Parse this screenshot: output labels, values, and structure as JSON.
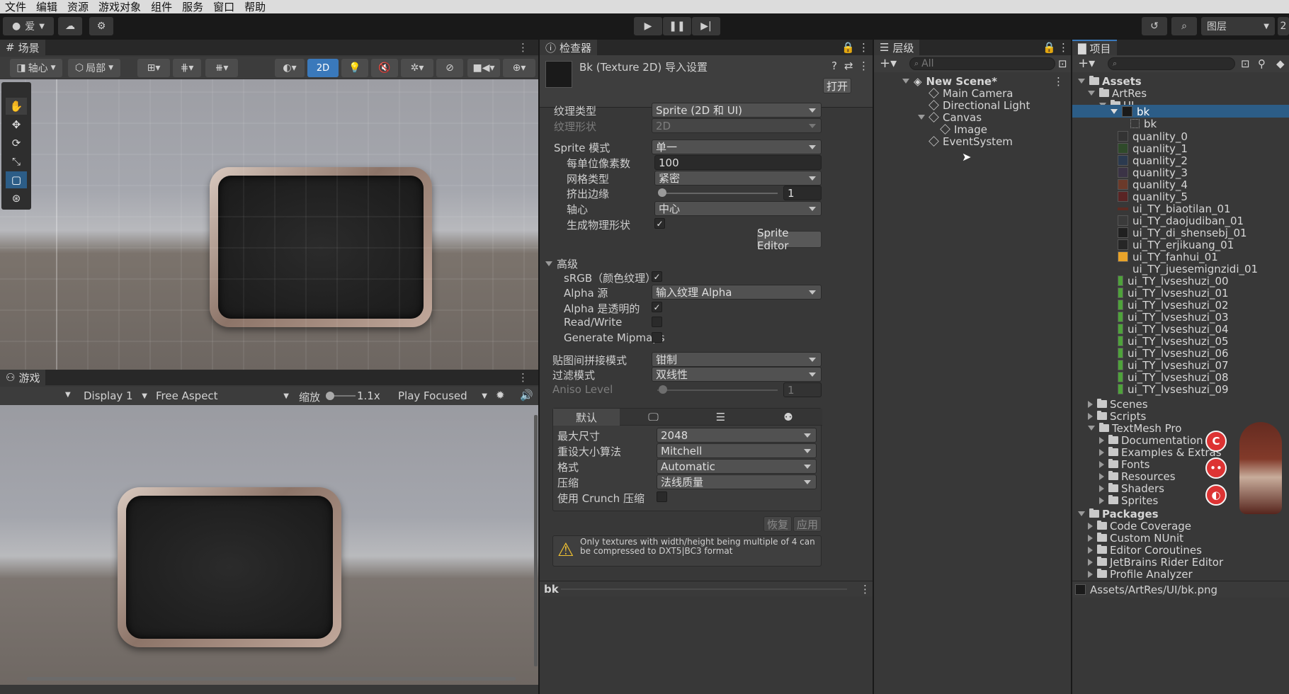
{
  "menu": [
    "文件",
    "编辑",
    "资源",
    "游戏对象",
    "组件",
    "服务",
    "窗口",
    "帮助"
  ],
  "toolbar": {
    "account": "爱",
    "layers": "图层",
    "layout_num": "2"
  },
  "scene": {
    "tab": "场景",
    "pivot": "轴心",
    "local": "局部",
    "mode2d": "2D"
  },
  "game": {
    "tab": "游戏",
    "display": "Display 1",
    "aspect": "Free Aspect",
    "scale_label": "缩放",
    "scale_value": "1.1x",
    "play_mode": "Play Focused"
  },
  "inspector": {
    "tab": "检查器",
    "title": "Bk (Texture 2D) 导入设置",
    "open_btn": "打开",
    "texture_type_label": "纹理类型",
    "texture_type": "Sprite (2D 和 UI)",
    "texture_shape_label": "纹理形状",
    "texture_shape": "2D",
    "sprite_mode_label": "Sprite 模式",
    "sprite_mode": "单一",
    "ppu_label": "每单位像素数",
    "ppu": "100",
    "mesh_type_label": "网格类型",
    "mesh_type": "紧密",
    "extrude_label": "挤出边缘",
    "extrude": "1",
    "pivot_label": "轴心",
    "pivot": "中心",
    "physics_label": "生成物理形状",
    "sprite_editor": "Sprite Editor",
    "advanced": "高级",
    "srgb_label": "sRGB（颜色纹理）",
    "alpha_source_label": "Alpha 源",
    "alpha_source": "输入纹理 Alpha",
    "alpha_transparent_label": "Alpha 是透明的",
    "readwrite_label": "Read/Write",
    "mipmaps_label": "Generate Mipmaps",
    "wrap_label": "贴图间拼接模式",
    "wrap": "钳制",
    "filter_label": "过滤模式",
    "filter": "双线性",
    "aniso_label": "Aniso Level",
    "aniso": "1",
    "platform_default": "默认",
    "max_size_label": "最大尺寸",
    "max_size": "2048",
    "resize_label": "重设大小算法",
    "resize": "Mitchell",
    "format_label": "格式",
    "format": "Automatic",
    "compression_label": "压缩",
    "compression": "法线质量",
    "crunch_label": "使用 Crunch 压缩",
    "revert": "恢复",
    "apply": "应用",
    "warning": "Only textures with width/height being multiple of 4 can be compressed to DXT5|BC3 format",
    "footer": "bk"
  },
  "hierarchy": {
    "tab": "层级",
    "search": "All",
    "scene": "New Scene*",
    "items": [
      "Main Camera",
      "Directional Light",
      "Canvas",
      "Image",
      "EventSystem"
    ]
  },
  "project": {
    "tab": "项目",
    "assets": "Assets",
    "artres": "ArtRes",
    "ui": "UI",
    "bk": "bk",
    "bk_sub": "bk",
    "files": [
      "quanlity_0",
      "quanlity_1",
      "quanlity_2",
      "quanlity_3",
      "quanlity_4",
      "quanlity_5",
      "ui_TY_biaotilan_01",
      "ui_TY_daojudiban_01",
      "ui_TY_di_shensebj_01",
      "ui_TY_erjikuang_01",
      "ui_TY_fanhui_01",
      "ui_TY_juesemignzidi_01",
      "ui_TY_lvseshuzi_00",
      "ui_TY_lvseshuzi_01",
      "ui_TY_lvseshuzi_02",
      "ui_TY_lvseshuzi_03",
      "ui_TY_lvseshuzi_04",
      "ui_TY_lvseshuzi_05",
      "ui_TY_lvseshuzi_06",
      "ui_TY_lvseshuzi_07",
      "ui_TY_lvseshuzi_08",
      "ui_TY_lvseshuzi_09"
    ],
    "asset_folders": [
      "Scenes",
      "Scripts",
      "TextMesh Pro"
    ],
    "tmp_folders": [
      "Documentation",
      "Examples & Extras",
      "Fonts",
      "Resources",
      "Shaders",
      "Sprites"
    ],
    "packages": "Packages",
    "package_folders": [
      "Code Coverage",
      "Custom NUnit",
      "Editor Coroutines",
      "JetBrains Rider Editor",
      "Profile Analyzer"
    ],
    "path": "Assets/ArtRes/UI/bk.png"
  },
  "colors": {
    "selection": "#2c5d87",
    "panel": "#383838",
    "accent_blue": "#3a79bb"
  }
}
